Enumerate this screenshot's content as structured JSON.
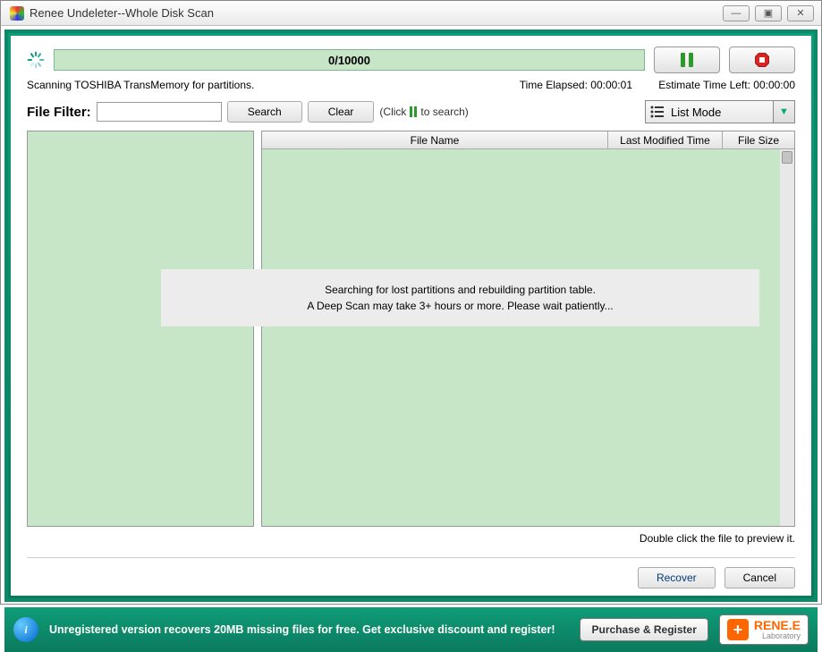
{
  "window": {
    "title": "Renee Undeleter--Whole Disk Scan"
  },
  "progress": {
    "text": "0/10000"
  },
  "buttons": {
    "pause": "Pause",
    "stop": "Stop"
  },
  "status": {
    "scanning": "Scanning TOSHIBA TransMemory for partitions.",
    "elapsed_label": "Time Elapsed: ",
    "elapsed_value": "00:00:01",
    "estimate_label": "Estimate Time Left: ",
    "estimate_value": "00:00:00"
  },
  "filter": {
    "label": "File  Filter:",
    "value": "",
    "search": "Search",
    "clear": "Clear",
    "hint_pre": "(Click",
    "hint_post": "to search)"
  },
  "listmode": {
    "label": "List Mode"
  },
  "columns": {
    "file_name": "File Name",
    "modified": "Last Modified Time",
    "size": "File Size"
  },
  "overlay": {
    "line1": "Searching for lost partitions and rebuilding partition table.",
    "line2": "A Deep Scan may take 3+ hours or more. Please wait patiently..."
  },
  "preview_hint": "Double click the file to preview it.",
  "actions": {
    "recover": "Recover",
    "cancel": "Cancel"
  },
  "footer": {
    "message": "Unregistered version recovers 20MB missing files for free. Get exclusive discount and register!",
    "purchase": "Purchase & Register",
    "logo_main": "RENE.E",
    "logo_sub": "Laboratory"
  },
  "win_controls": {
    "min": "—",
    "max": "▣",
    "close": "✕"
  }
}
